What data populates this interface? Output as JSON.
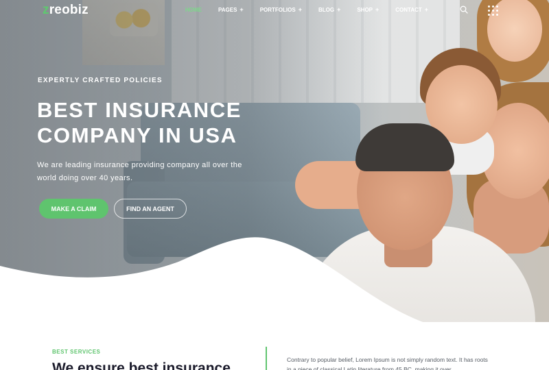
{
  "header": {
    "logo": {
      "mark": "z",
      "text": "reobiz"
    },
    "nav": [
      {
        "label": "HOME",
        "active": true
      },
      {
        "label": "PAGES",
        "active": false
      },
      {
        "label": "PORTFOLIOS",
        "active": false
      },
      {
        "label": "BLOG",
        "active": false
      },
      {
        "label": "SHOP",
        "active": false
      },
      {
        "label": "CONTACT",
        "active": false
      }
    ],
    "nav_plus": "+",
    "icons": [
      "search-icon",
      "grid-icon"
    ]
  },
  "hero": {
    "tagline": "EXPERTLY CRAFTED POLICIES",
    "headline_line1": "BEST INSURANCE",
    "headline_line2": "COMPANY IN USA",
    "subtext": "We are leading insurance providing company all over the world doing over 40 years.",
    "primary_button": "MAKE A CLAIM",
    "secondary_button": "FIND AN AGENT"
  },
  "services": {
    "label": "BEST SERVICES",
    "title": "We ensure best insurance",
    "text": "Contrary to popular belief, Lorem Ipsum is not simply random text. It has roots in a piece of classical Latin literature from 45 BC, making it over"
  },
  "colors": {
    "accent": "#5fc46e",
    "nav_active": "#7cd88a",
    "heading_dark": "#1b1b2b",
    "text_gray": "#555b63"
  }
}
